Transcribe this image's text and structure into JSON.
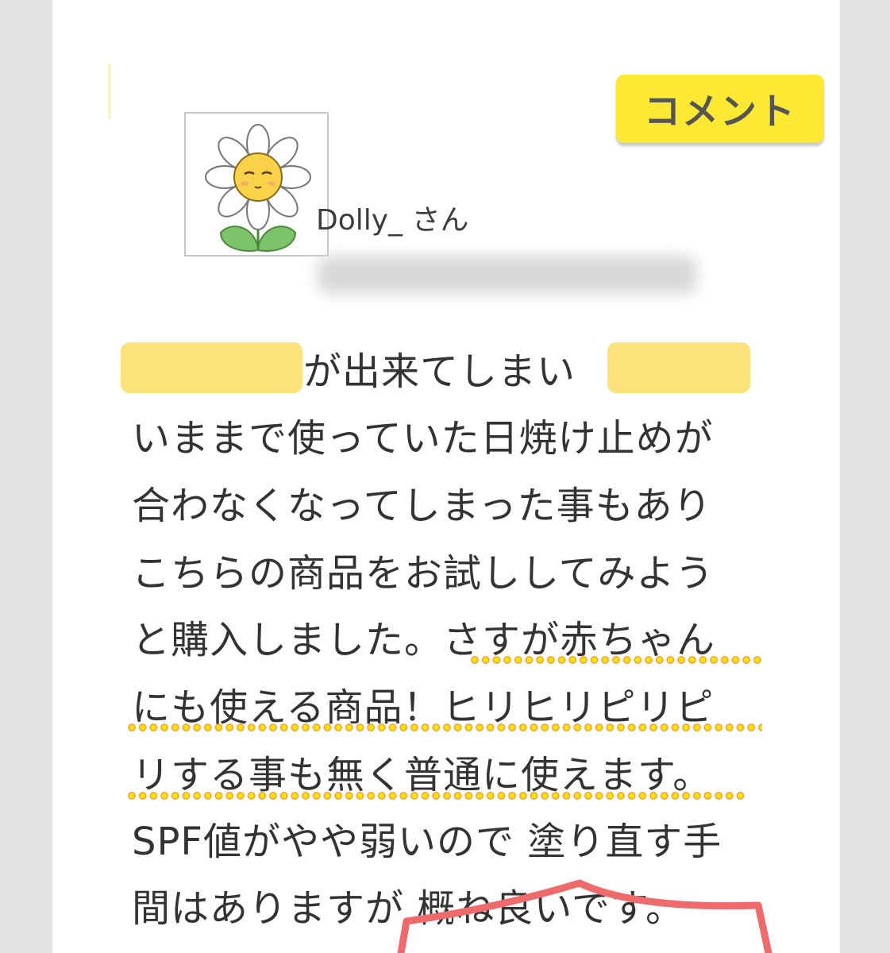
{
  "badge": {
    "label": "コメント"
  },
  "user": {
    "name": "Dolly_ さん",
    "avatar_icon": "daisy-flower-avatar-icon",
    "timestamp_redacted": true
  },
  "review": {
    "lines": [
      "が出来てしまい",
      "いままで使っていた日焼け止めが",
      "合わなくなってしまった事もあり",
      "こちらの商品をお試ししてみよう",
      "と購入しました。さすが赤ちゃん",
      "にも使える商品！ヒリヒリピリピ",
      "リする事も無く普通に使えます。",
      "SPF値がやや弱いので 塗り直す手",
      "間はありますが 概ね良いです。"
    ],
    "redacted_highlights": 2
  },
  "colors": {
    "badge": "#fde834",
    "highlight": "#fde17a",
    "dot_fill": "#ffe600",
    "dot_outline": "#f08a2a",
    "speech_bubble": "#ef6b6b"
  }
}
